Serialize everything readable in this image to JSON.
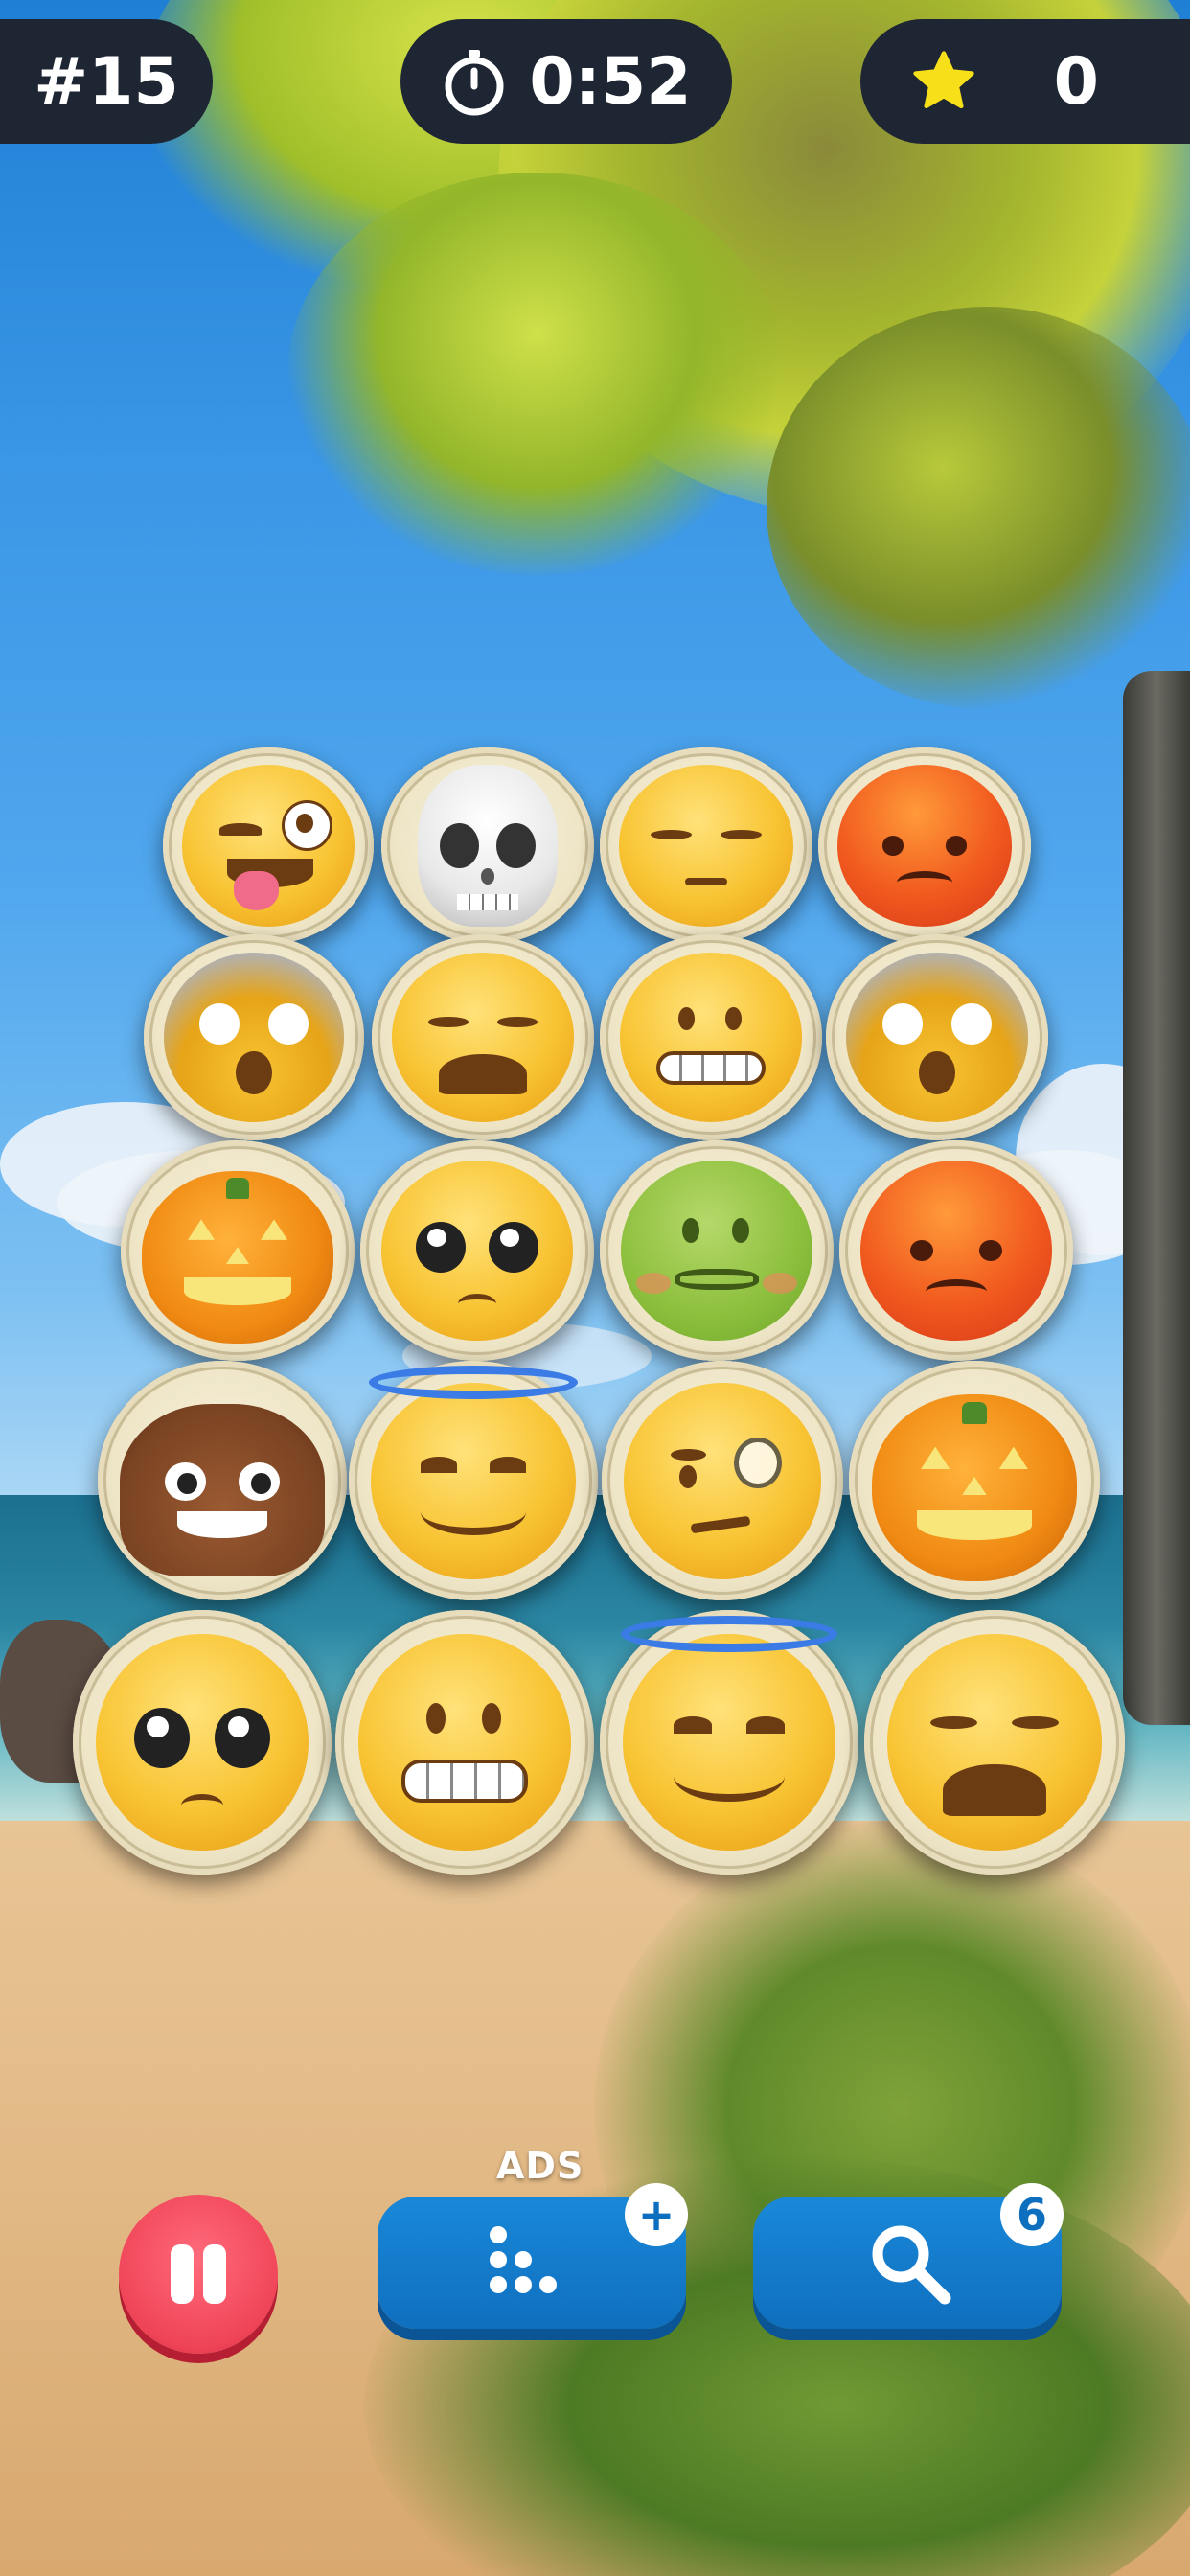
{
  "hud": {
    "level": "#15",
    "timer": "0:52",
    "stars": "0"
  },
  "board": {
    "rows": [
      [
        "winking-tongue-emoji",
        "skull-emoji",
        "pensive-emoji",
        "angry-emoji"
      ],
      [
        "screaming-emoji",
        "weary-emoji",
        "grimacing-emoji",
        "screaming-emoji"
      ],
      [
        "jack-o-lantern-emoji",
        "pleading-emoji",
        "nauseated-emoji",
        "angry-emoji"
      ],
      [
        "poop-emoji",
        "halo-smile-emoji",
        "monocle-emoji",
        "jack-o-lantern-emoji"
      ],
      [
        "pleading-emoji",
        "grimacing-emoji",
        "halo-smile-emoji",
        "weary-emoji"
      ]
    ]
  },
  "controls": {
    "ads_label": "ADS",
    "hint_count": "6",
    "add_symbol": "+"
  },
  "colors": {
    "hud_bg": "#1e2634",
    "star": "#f7e01a",
    "pause": "#f04458",
    "button_blue": "#0f6fbf"
  }
}
